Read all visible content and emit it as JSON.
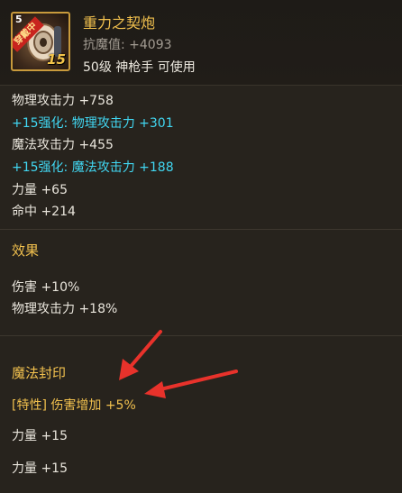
{
  "item": {
    "icon_level": "5",
    "icon_badge": "穿戴中",
    "icon_plus": "15",
    "name": "重力之契炮",
    "resist": "抗魔值: +4093",
    "requirement": "50级 神枪手 可使用"
  },
  "stats": [
    {
      "text": "物理攻击力 +758"
    },
    {
      "text": "+15强化: 物理攻击力 +301"
    },
    {
      "text": "魔法攻击力 +455"
    },
    {
      "text": "+15强化: 魔法攻击力 +188"
    },
    {
      "text": "力量 +65"
    },
    {
      "text": "命中 +214"
    }
  ],
  "effect": {
    "title": "效果",
    "lines": [
      "伤害 +10%",
      "物理攻击力 +18%"
    ]
  },
  "seal": {
    "title": "魔法封印",
    "trait": "[特性] 伤害增加 +5%",
    "lines": [
      "力量 +15",
      "力量 +15"
    ]
  },
  "colors": {
    "gold": "#f2c14e",
    "cyan": "#41d7f2",
    "arrow": "#e8322b"
  }
}
